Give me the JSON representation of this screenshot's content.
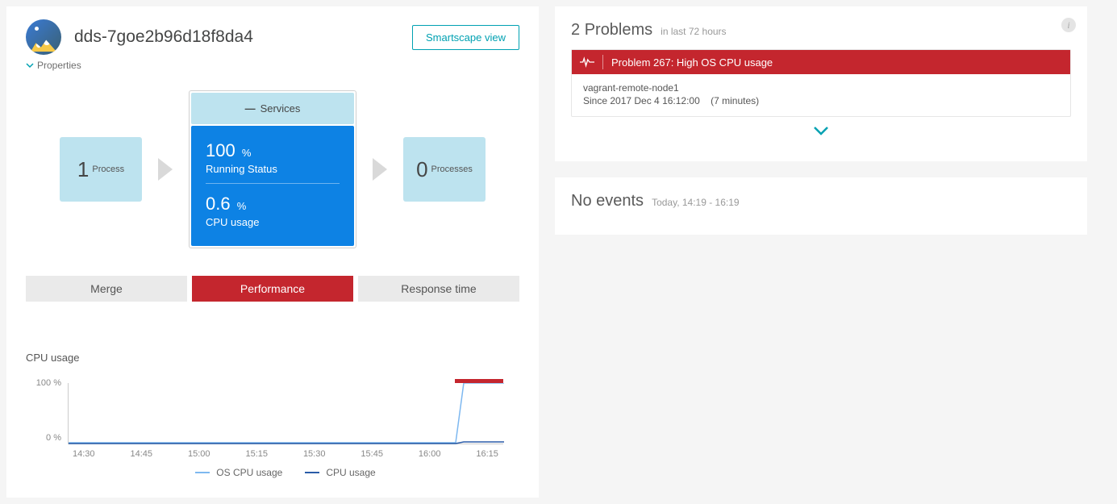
{
  "header": {
    "title": "dds-7goe2b96d18f8da4",
    "smartscape_btn": "Smartscape view",
    "properties_label": "Properties"
  },
  "flow": {
    "left_num": "1",
    "left_label": "Process",
    "services_label": "Services",
    "stat1_val": "100",
    "stat1_unit": "%",
    "stat1_label": "Running Status",
    "stat2_val": "0.6",
    "stat2_unit": "%",
    "stat2_label": "CPU usage",
    "right_num": "0",
    "right_label": "Processes"
  },
  "tabs": {
    "merge": "Merge",
    "performance": "Performance",
    "response_time": "Response time"
  },
  "chart": {
    "title": "CPU usage",
    "ytick_top": "100 %",
    "ytick_bot": "0 %",
    "legend_os": "OS CPU usage",
    "legend_cpu": "CPU usage",
    "xticks": [
      "14:30",
      "14:45",
      "15:00",
      "15:15",
      "15:30",
      "15:45",
      "16:00",
      "16:15"
    ]
  },
  "problems": {
    "count": "2",
    "title": "Problems",
    "subtitle": "in last 72 hours",
    "item_title": "Problem 267: High OS CPU usage",
    "item_host": "vagrant-remote-node1",
    "item_since": "Since 2017 Dec 4 16:12:00",
    "item_duration": "(7 minutes)"
  },
  "events": {
    "title": "No events",
    "subtitle": "Today, 14:19 - 16:19"
  },
  "chart_data": {
    "type": "line",
    "title": "CPU usage",
    "xlabel": "",
    "ylabel": "Percent",
    "ylim": [
      0,
      100
    ],
    "categories": [
      "14:30",
      "14:45",
      "15:00",
      "15:15",
      "15:30",
      "15:45",
      "16:00",
      "16:15"
    ],
    "series": [
      {
        "name": "OS CPU usage",
        "values": [
          1,
          1,
          1,
          1,
          1,
          1,
          1,
          100
        ]
      },
      {
        "name": "CPU usage",
        "values": [
          1,
          1,
          1,
          1,
          1,
          1,
          1,
          3
        ]
      }
    ]
  }
}
